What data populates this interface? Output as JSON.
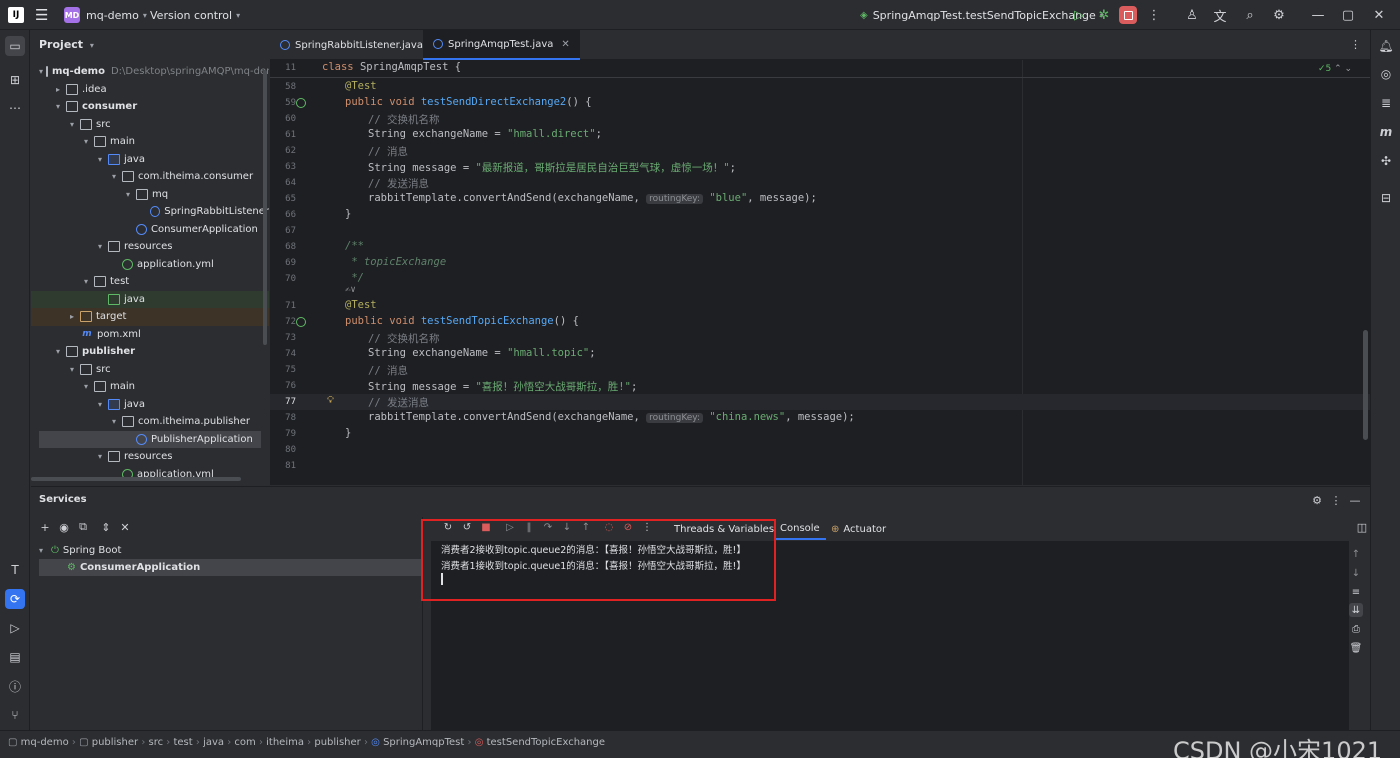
{
  "titlebar": {
    "logo": "IJ",
    "project_badge": "MD",
    "project_name": "mq-demo",
    "vcs": "Version control",
    "run_config": "SpringAmqpTest.testSendTopicExchange"
  },
  "project_panel": {
    "title": "Project",
    "rows": [
      {
        "label": "mq-demo",
        "path": "D:\\Desktop\\springAMQP\\mq-demo"
      },
      {
        "label": ".idea"
      },
      {
        "label": "consumer"
      },
      {
        "label": "src"
      },
      {
        "label": "main"
      },
      {
        "label": "java"
      },
      {
        "label": "com.itheima.consumer"
      },
      {
        "label": "mq"
      },
      {
        "label": "SpringRabbitListener"
      },
      {
        "label": "ConsumerApplication"
      },
      {
        "label": "resources"
      },
      {
        "label": "application.yml"
      },
      {
        "label": "test"
      },
      {
        "label": "java"
      },
      {
        "label": "target"
      },
      {
        "label": "pom.xml"
      },
      {
        "label": "publisher"
      },
      {
        "label": "src"
      },
      {
        "label": "main"
      },
      {
        "label": "java"
      },
      {
        "label": "com.itheima.publisher"
      },
      {
        "label": "PublisherApplication"
      },
      {
        "label": "resources"
      },
      {
        "label": "application.yml"
      }
    ]
  },
  "editor": {
    "tabs": [
      {
        "label": "SpringRabbitListener.java"
      },
      {
        "label": "SpringAmqpTest.java"
      }
    ],
    "inspections": "5",
    "header_line": {
      "num": "11",
      "text": "class SpringAmqpTest {"
    },
    "line_numbers": [
      "58",
      "59",
      "60",
      "61",
      "62",
      "63",
      "64",
      "65",
      "66",
      "67",
      "68",
      "69",
      "70",
      "71",
      "72",
      "73",
      "74",
      "75",
      "76",
      "77",
      "78",
      "79",
      "80",
      "81"
    ],
    "code": {
      "l58": "@Test",
      "l59_kw": "public void ",
      "l59_fn": "testSendDirectExchange2",
      "l59_rest": "() {",
      "l60": "// 交换机名称",
      "l61_a": "String exchangeName = ",
      "l61_s": "\"hmall.direct\"",
      "l61_b": ";",
      "l62": "// 消息",
      "l63_a": "String message = ",
      "l63_s": "\"最新报道，哥斯拉是居民自治巨型气球，虚惊一场！\"",
      "l63_b": ";",
      "l64": "// 发送消息",
      "l65_a": "rabbitTemplate.convertAndSend(exchangeName, ",
      "l65_hint": "routingKey:",
      "l65_s": " \"blue\"",
      "l65_b": ", message);",
      "l66": "}",
      "l68": "/**",
      "l69": " * topicExchange",
      "l70": " */",
      "l70b": "✍∨",
      "l71": "@Test",
      "l72_kw": "public void ",
      "l72_fn": "testSendTopicExchange",
      "l72_rest": "() {",
      "l73": "// 交换机名称",
      "l74_a": "String exchangeName = ",
      "l74_s": "\"hmall.topic\"",
      "l74_b": ";",
      "l75": "// 消息",
      "l76_a": "String message = ",
      "l76_s": "\"喜报！孙悟空大战哥斯拉，胜!\"",
      "l76_b": ";",
      "l77": "// 发送消息",
      "l78_a": "rabbitTemplate.convertAndSend(exchangeName, ",
      "l78_hint": "routingKey:",
      "l78_s": " \"china.news\"",
      "l78_b": ", message);",
      "l79": "}"
    }
  },
  "services": {
    "title": "Services",
    "tree": [
      {
        "label": "Spring Boot"
      },
      {
        "label": "ConsumerApplication"
      }
    ],
    "tabs": [
      {
        "label": "Threads & Variables"
      },
      {
        "label": "Console"
      },
      {
        "label": "Actuator"
      }
    ],
    "console_lines": [
      "消费者2接收到topic.queue2的消息：【喜报！孙悟空大战哥斯拉，胜!】",
      "消费者1接收到topic.queue1的消息：【喜报！孙悟空大战哥斯拉，胜!】"
    ]
  },
  "statusbar": {
    "breadcrumbs": [
      "mq-demo",
      "publisher",
      "src",
      "test",
      "java",
      "com",
      "itheima",
      "publisher",
      "SpringAmqpTest",
      "testSendTopicExchange"
    ],
    "watermark": "CSDN @小宋1021"
  },
  "colors": {
    "accent": "#3574f0",
    "highlight_box": "#e02222",
    "editor_bg": "#1e1f22",
    "panel_bg": "#2b2d30"
  }
}
